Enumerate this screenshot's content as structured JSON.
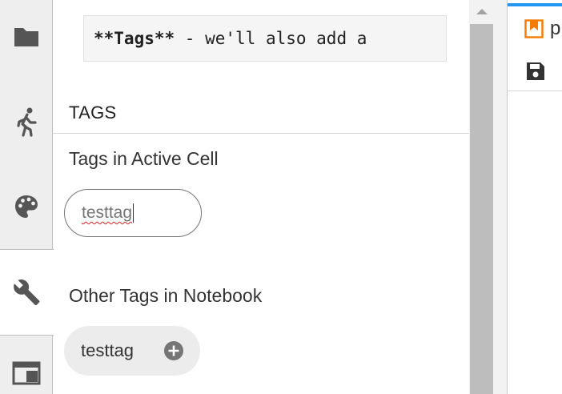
{
  "activity_bar": {
    "tabs": [
      {
        "name": "file-browser",
        "icon": "folder-icon"
      },
      {
        "name": "running",
        "icon": "running-icon"
      },
      {
        "name": "commands",
        "icon": "palette-icon"
      },
      {
        "name": "tools",
        "icon": "wrench-icon",
        "active": true
      },
      {
        "name": "tabs",
        "icon": "window-icon"
      }
    ]
  },
  "cell_preview": {
    "bold_text": "**Tags**",
    "text": " - we'll also add a"
  },
  "tags_panel": {
    "title": "TAGS",
    "active_cell_label": "Tags in Active Cell",
    "active_input_value": "testtag",
    "other_tags_label": "Other Tags in Notebook",
    "other_tags": [
      "testtag"
    ]
  },
  "notebook": {
    "tab_title": "p",
    "accent_color": "#2196f3",
    "icon_color": "#f57c00"
  }
}
